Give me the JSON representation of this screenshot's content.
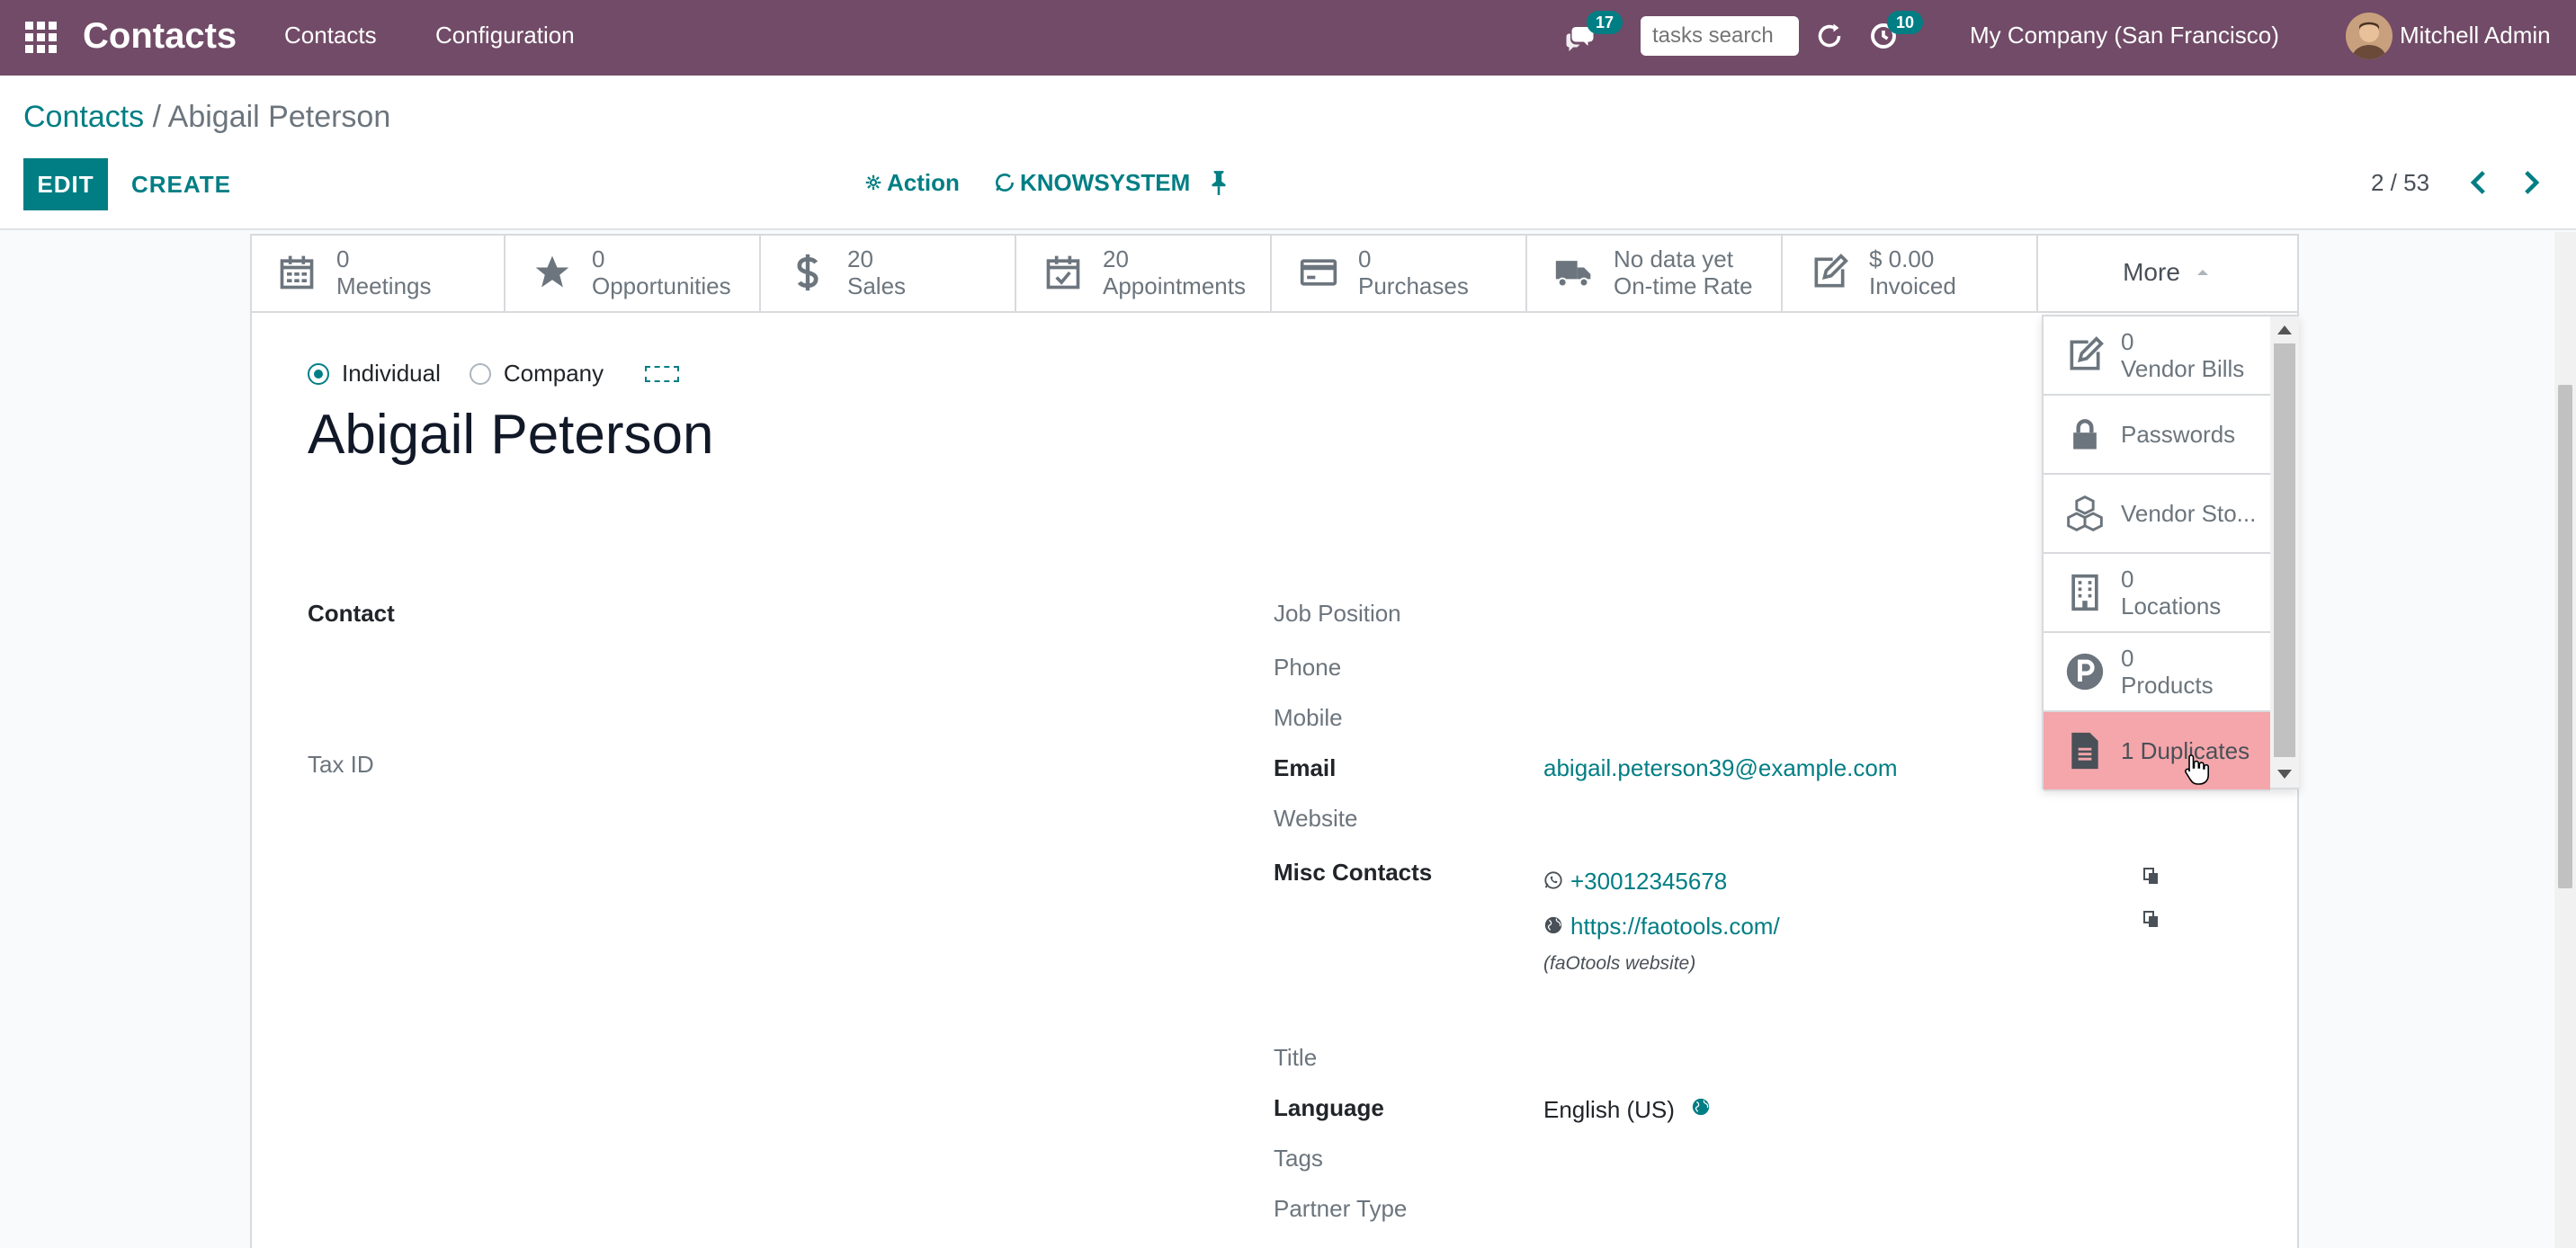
{
  "navbar": {
    "brand": "Contacts",
    "menu": [
      "Contacts",
      "Configuration"
    ],
    "messages_badge": "17",
    "tasks_search_placeholder": "tasks search",
    "activities_badge": "10",
    "company": "My Company (San Francisco)",
    "user": "Mitchell Admin",
    "color": "#714b67"
  },
  "control_panel": {
    "breadcrumb_parent": "Contacts",
    "breadcrumb_sep": " / ",
    "breadcrumb_current": "Abigail Peterson",
    "edit_label": "EDIT",
    "create_label": "CREATE",
    "action_label": "Action",
    "knowsystem_label": "KNOWSYSTEM",
    "pager": "2 / 53"
  },
  "smart_buttons": [
    {
      "value": "0",
      "label": "Meetings",
      "icon": "calendar-icon"
    },
    {
      "value": "0",
      "label": "Opportunities",
      "icon": "star-icon"
    },
    {
      "value": "20",
      "label": "Sales",
      "icon": "dollar-icon"
    },
    {
      "value": "20",
      "label": "Appointments",
      "icon": "calendar-check-icon"
    },
    {
      "value": "0",
      "label": "Purchases",
      "icon": "credit-card-icon"
    },
    {
      "value": "No data yet",
      "label": "On-time Rate",
      "icon": "truck-icon"
    },
    {
      "value": "$ 0.00",
      "label": "Invoiced",
      "icon": "pencil-square-icon"
    }
  ],
  "more_label": "More",
  "dropdown": [
    {
      "value": "0",
      "label": "Vendor Bills",
      "icon": "pencil-square-icon"
    },
    {
      "value": "",
      "label": "Passwords",
      "icon": "lock-icon"
    },
    {
      "value": "",
      "label": "Vendor Sto...",
      "icon": "cubes-icon"
    },
    {
      "value": "0",
      "label": "Locations",
      "icon": "building-icon"
    },
    {
      "value": "0",
      "label": "Products",
      "icon": "product-p-icon"
    },
    {
      "value": "",
      "label": "1 Duplicates",
      "icon": "file-text-icon"
    }
  ],
  "form": {
    "type_individual": "Individual",
    "type_company": "Company",
    "name": "Abigail Peterson",
    "contact_label": "Contact",
    "tax_id_label": "Tax ID",
    "job_position_label": "Job Position",
    "phone_label": "Phone",
    "mobile_label": "Mobile",
    "email_label": "Email",
    "email_value": "abigail.peterson39@example.com",
    "website_label": "Website",
    "misc_contacts_label": "Misc Contacts",
    "misc_phone": "+30012345678",
    "misc_url": "https://faotools.com/",
    "misc_url_note": "(faOtools website)",
    "title_label": "Title",
    "language_label": "Language",
    "language_value": "English (US)",
    "tags_label": "Tags",
    "partner_type_label": "Partner Type"
  },
  "colors": {
    "accent": "#017e84",
    "highlight": "#f4a6ab"
  }
}
